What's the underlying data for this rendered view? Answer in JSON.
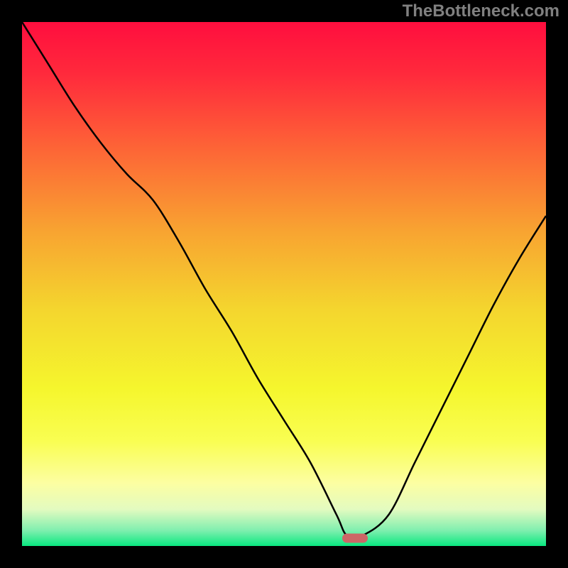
{
  "watermark": "TheBottleneck.com",
  "chart_data": {
    "type": "line",
    "title": "",
    "xlabel": "",
    "ylabel": "",
    "xlim": [
      0,
      100
    ],
    "ylim": [
      0,
      100
    ],
    "series": [
      {
        "name": "bottleneck-curve",
        "x": [
          0,
          5,
          10,
          15,
          20,
          25,
          30,
          35,
          40,
          45,
          50,
          55,
          60,
          62,
          65,
          70,
          75,
          80,
          85,
          90,
          95,
          100
        ],
        "y": [
          100,
          92,
          84,
          77,
          71,
          66,
          58,
          49,
          41,
          32,
          24,
          16,
          6,
          2,
          2,
          6,
          16,
          26,
          36,
          46,
          55,
          63
        ]
      }
    ],
    "marker": {
      "x": 63.5,
      "y": 1.5
    },
    "gradient_stops": [
      {
        "offset": 0.0,
        "color": "#FF0E3E"
      },
      {
        "offset": 0.1,
        "color": "#FF2A3C"
      },
      {
        "offset": 0.25,
        "color": "#FD6836"
      },
      {
        "offset": 0.4,
        "color": "#F8A431"
      },
      {
        "offset": 0.55,
        "color": "#F4D62E"
      },
      {
        "offset": 0.7,
        "color": "#F5F62D"
      },
      {
        "offset": 0.8,
        "color": "#F9FE52"
      },
      {
        "offset": 0.88,
        "color": "#FCFEA2"
      },
      {
        "offset": 0.93,
        "color": "#E3FBC0"
      },
      {
        "offset": 0.97,
        "color": "#80EFAF"
      },
      {
        "offset": 1.0,
        "color": "#09E880"
      }
    ]
  }
}
